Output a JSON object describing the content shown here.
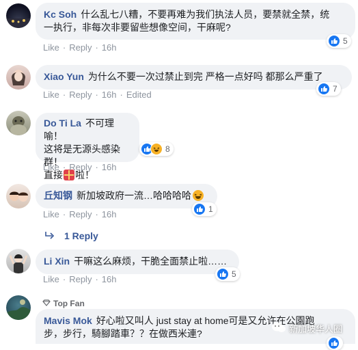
{
  "actions": {
    "like": "Like",
    "reply": "Reply",
    "sep": "·"
  },
  "comments": [
    {
      "author": "Kc Soh",
      "text_lines": [
        "什么乱七八糟，不要再难为我们执法人员，要禁就全禁，统",
        "一执行，非每次非要留些想像空间，干麻呢?"
      ],
      "time": "16h",
      "edited": "",
      "reaction_count": "5",
      "reactions": [
        "like"
      ]
    },
    {
      "author": "Xiao Yun",
      "text_lines": [
        "为什么不要一次过禁止到完 严格一点好吗 都那么严重了"
      ],
      "time": "16h",
      "edited": "Edited",
      "reaction_count": "7",
      "reactions": [
        "like"
      ]
    },
    {
      "author": "Do Ti La",
      "text_lines": [
        "不可理喻！",
        "这将是无源头感染群！",
        "直接",
        "啦！"
      ],
      "time": "16h",
      "edited": "",
      "reaction_count": "8",
      "reactions": [
        "like",
        "haha"
      ]
    },
    {
      "author": "丘知钢",
      "text_lines": [
        "新加坡政府一流…哈哈哈哈"
      ],
      "time": "16h",
      "edited": "",
      "reaction_count": "1",
      "reactions": [
        "like"
      ]
    },
    {
      "author": "Li Xin",
      "text_lines": [
        "干嘛这么麻烦，干脆全面禁止啦……"
      ],
      "time": "16h",
      "edited": "",
      "reaction_count": "5",
      "reactions": [
        "like"
      ]
    },
    {
      "author": "Mavis Mok",
      "badge": "Top Fan",
      "text_lines": [
        "好心啦又叫人 just stay at home可是又允许在公園跑",
        "步，步行，騎腳踏車？？在做西米連?"
      ],
      "time": "",
      "edited": "",
      "reaction_count": "",
      "reactions": [
        "like"
      ]
    }
  ],
  "reply_link": "1 Reply",
  "watermark": "新加坡华人圈",
  "colors": {
    "author": "#385898",
    "bubble": "#f0f2f5",
    "meta": "#8d949e",
    "like": "#1877f2",
    "haha": "#f7b125"
  }
}
